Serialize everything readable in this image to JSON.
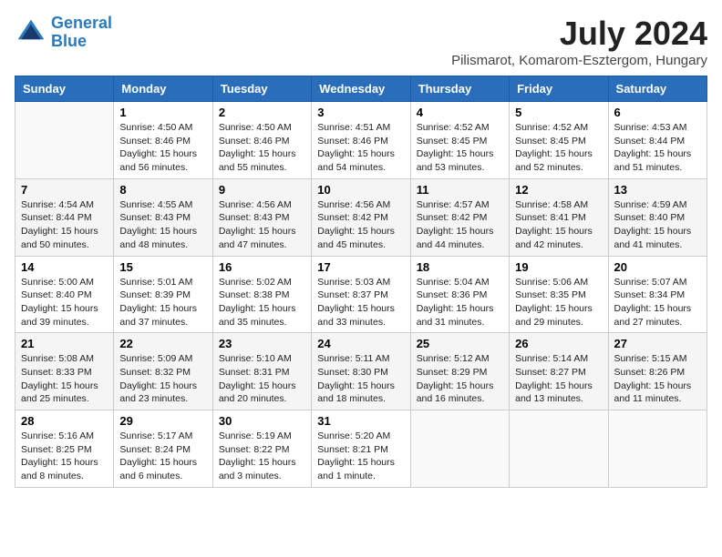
{
  "header": {
    "logo_line1": "General",
    "logo_line2": "Blue",
    "title": "July 2024",
    "subtitle": "Pilismarot, Komarom-Esztergom, Hungary"
  },
  "columns": [
    "Sunday",
    "Monday",
    "Tuesday",
    "Wednesday",
    "Thursday",
    "Friday",
    "Saturday"
  ],
  "weeks": [
    [
      {
        "day": "",
        "detail": ""
      },
      {
        "day": "1",
        "detail": "Sunrise: 4:50 AM\nSunset: 8:46 PM\nDaylight: 15 hours\nand 56 minutes."
      },
      {
        "day": "2",
        "detail": "Sunrise: 4:50 AM\nSunset: 8:46 PM\nDaylight: 15 hours\nand 55 minutes."
      },
      {
        "day": "3",
        "detail": "Sunrise: 4:51 AM\nSunset: 8:46 PM\nDaylight: 15 hours\nand 54 minutes."
      },
      {
        "day": "4",
        "detail": "Sunrise: 4:52 AM\nSunset: 8:45 PM\nDaylight: 15 hours\nand 53 minutes."
      },
      {
        "day": "5",
        "detail": "Sunrise: 4:52 AM\nSunset: 8:45 PM\nDaylight: 15 hours\nand 52 minutes."
      },
      {
        "day": "6",
        "detail": "Sunrise: 4:53 AM\nSunset: 8:44 PM\nDaylight: 15 hours\nand 51 minutes."
      }
    ],
    [
      {
        "day": "7",
        "detail": "Sunrise: 4:54 AM\nSunset: 8:44 PM\nDaylight: 15 hours\nand 50 minutes."
      },
      {
        "day": "8",
        "detail": "Sunrise: 4:55 AM\nSunset: 8:43 PM\nDaylight: 15 hours\nand 48 minutes."
      },
      {
        "day": "9",
        "detail": "Sunrise: 4:56 AM\nSunset: 8:43 PM\nDaylight: 15 hours\nand 47 minutes."
      },
      {
        "day": "10",
        "detail": "Sunrise: 4:56 AM\nSunset: 8:42 PM\nDaylight: 15 hours\nand 45 minutes."
      },
      {
        "day": "11",
        "detail": "Sunrise: 4:57 AM\nSunset: 8:42 PM\nDaylight: 15 hours\nand 44 minutes."
      },
      {
        "day": "12",
        "detail": "Sunrise: 4:58 AM\nSunset: 8:41 PM\nDaylight: 15 hours\nand 42 minutes."
      },
      {
        "day": "13",
        "detail": "Sunrise: 4:59 AM\nSunset: 8:40 PM\nDaylight: 15 hours\nand 41 minutes."
      }
    ],
    [
      {
        "day": "14",
        "detail": "Sunrise: 5:00 AM\nSunset: 8:40 PM\nDaylight: 15 hours\nand 39 minutes."
      },
      {
        "day": "15",
        "detail": "Sunrise: 5:01 AM\nSunset: 8:39 PM\nDaylight: 15 hours\nand 37 minutes."
      },
      {
        "day": "16",
        "detail": "Sunrise: 5:02 AM\nSunset: 8:38 PM\nDaylight: 15 hours\nand 35 minutes."
      },
      {
        "day": "17",
        "detail": "Sunrise: 5:03 AM\nSunset: 8:37 PM\nDaylight: 15 hours\nand 33 minutes."
      },
      {
        "day": "18",
        "detail": "Sunrise: 5:04 AM\nSunset: 8:36 PM\nDaylight: 15 hours\nand 31 minutes."
      },
      {
        "day": "19",
        "detail": "Sunrise: 5:06 AM\nSunset: 8:35 PM\nDaylight: 15 hours\nand 29 minutes."
      },
      {
        "day": "20",
        "detail": "Sunrise: 5:07 AM\nSunset: 8:34 PM\nDaylight: 15 hours\nand 27 minutes."
      }
    ],
    [
      {
        "day": "21",
        "detail": "Sunrise: 5:08 AM\nSunset: 8:33 PM\nDaylight: 15 hours\nand 25 minutes."
      },
      {
        "day": "22",
        "detail": "Sunrise: 5:09 AM\nSunset: 8:32 PM\nDaylight: 15 hours\nand 23 minutes."
      },
      {
        "day": "23",
        "detail": "Sunrise: 5:10 AM\nSunset: 8:31 PM\nDaylight: 15 hours\nand 20 minutes."
      },
      {
        "day": "24",
        "detail": "Sunrise: 5:11 AM\nSunset: 8:30 PM\nDaylight: 15 hours\nand 18 minutes."
      },
      {
        "day": "25",
        "detail": "Sunrise: 5:12 AM\nSunset: 8:29 PM\nDaylight: 15 hours\nand 16 minutes."
      },
      {
        "day": "26",
        "detail": "Sunrise: 5:14 AM\nSunset: 8:27 PM\nDaylight: 15 hours\nand 13 minutes."
      },
      {
        "day": "27",
        "detail": "Sunrise: 5:15 AM\nSunset: 8:26 PM\nDaylight: 15 hours\nand 11 minutes."
      }
    ],
    [
      {
        "day": "28",
        "detail": "Sunrise: 5:16 AM\nSunset: 8:25 PM\nDaylight: 15 hours\nand 8 minutes."
      },
      {
        "day": "29",
        "detail": "Sunrise: 5:17 AM\nSunset: 8:24 PM\nDaylight: 15 hours\nand 6 minutes."
      },
      {
        "day": "30",
        "detail": "Sunrise: 5:19 AM\nSunset: 8:22 PM\nDaylight: 15 hours\nand 3 minutes."
      },
      {
        "day": "31",
        "detail": "Sunrise: 5:20 AM\nSunset: 8:21 PM\nDaylight: 15 hours\nand 1 minute."
      },
      {
        "day": "",
        "detail": ""
      },
      {
        "day": "",
        "detail": ""
      },
      {
        "day": "",
        "detail": ""
      }
    ]
  ]
}
